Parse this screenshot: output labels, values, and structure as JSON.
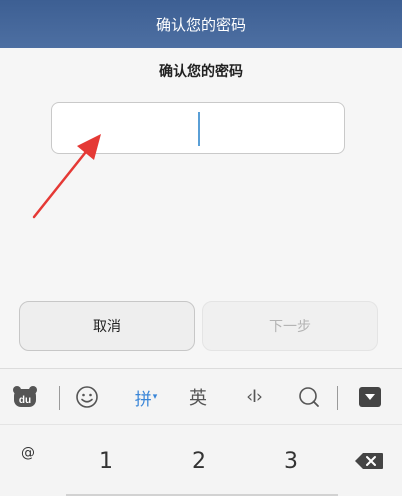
{
  "titlebar": {
    "title": "确认您的密码"
  },
  "main": {
    "prompt": "确认您的密码",
    "password_digits": [
      "",
      ""
    ]
  },
  "buttons": {
    "cancel_label": "取消",
    "next_label": "下一步"
  },
  "ime_toolbar": {
    "pinyin_label": "拼",
    "english_label": "英"
  },
  "keyboard": {
    "row": [
      "@",
      "1",
      "2",
      "3"
    ]
  },
  "colors": {
    "titlebar": "#4565a0",
    "caret": "#5a9fd6",
    "pinyin_accent": "#3a86d8",
    "annotation_arrow": "#e53935"
  },
  "icons": [
    "du-bear-logo-icon",
    "emoji-icon",
    "dropdown-caret-icon",
    "cursor-move-icon",
    "search-icon",
    "keyboard-hide-icon",
    "backspace-icon",
    "annotation-arrow-icon"
  ]
}
